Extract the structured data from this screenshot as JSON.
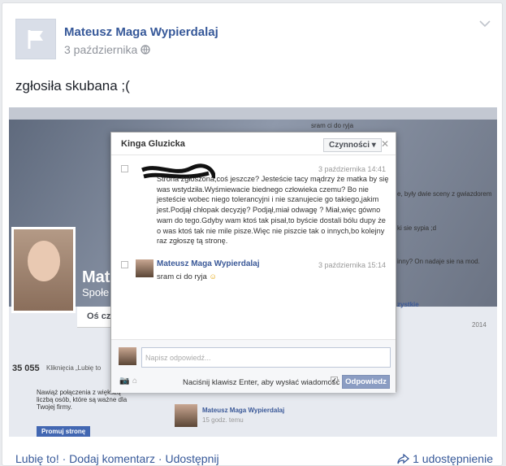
{
  "post": {
    "author": "Mateusz Maga Wypierdalaj",
    "date": "3 października",
    "text": "zgłosiła skubana ;("
  },
  "screenshot": {
    "bg_name_fragment": "Mate",
    "bg_subtitle_fragment": "Społe",
    "bg_tab_fragment": "Oś cza",
    "bg_likes_count": "35 055",
    "bg_likes_text": "Kliknięcia „Lubię to",
    "bg_promo_text": "Nawiąż połączenia z większą liczbą osób, które są ważne dla Twojej firmy.",
    "bg_promo_button": "Promuj stronę",
    "bg_comment_top": "sram ci do ryja",
    "bg_right_1": "e, były dwie sceny z gwiazdorem",
    "bg_right_2": "ki sie sypia ;d",
    "bg_right_3": "inny? On nadaje sie na mod.",
    "bg_right_4": "zystkie",
    "bg_year": "2014",
    "bg_post_author": "Mateusz Maga Wypierdalaj",
    "bg_post_time": "15 godz. temu"
  },
  "modal": {
    "title": "Kinga Gluzicka",
    "actions_label": "Czynności",
    "close_glyph": "✕",
    "msg1_time": "3 października 14:41",
    "msg1_text": "Strona zgłoszona,coś jeszcze? Jesteście tacy mądrzy że matka by się was wstydziła.Wyśmiewacie biednego człowieka czemu? Bo nie jesteście wobec niego tolerancyjni i nie szanujecie go takiego,jakim jest.Podjął chłopak decyzję? Podjął,miał odwagę ? Miał,więc gówno wam do tego.Gdyby wam ktoś tak pisał,to byście dostali bólu dupy że o was ktoś tak nie mile pisze.Więc nie piszcie tak o innych,bo kolejny raz zgłoszę tą stronę.",
    "msg2_author": "Mateusz Maga Wypierdalaj",
    "msg2_time": "3 października 15:14",
    "msg2_text": "sram ci do ryja",
    "reply_placeholder": "Napisz odpowiedź...",
    "enter_label": "Naciśnij klawisz Enter, aby wysłać wiadomość",
    "reply_button": "Odpowiedz"
  },
  "footer": {
    "like": "Lubię to!",
    "comment": "Dodaj komentarz",
    "share": "Udostępnij",
    "sep": " · ",
    "shares_count": "1 udostępnienie"
  },
  "colors": {
    "link": "#365899",
    "muted": "#90949c",
    "fb_blue": "#3b5998"
  },
  "icons": [
    "flag-icon",
    "globe-icon",
    "chevron-down-icon",
    "share-arrow-icon",
    "camera-icon",
    "paperclip-icon",
    "checkbox-icon",
    "smiley-icon"
  ]
}
